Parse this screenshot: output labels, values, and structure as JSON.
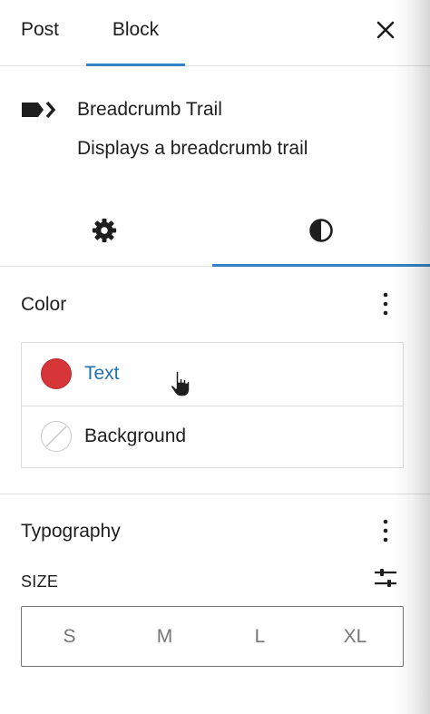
{
  "top_tabs": {
    "post": "Post",
    "block": "Block"
  },
  "block": {
    "title": "Breadcrumb Trail",
    "description": "Displays a breadcrumb trail"
  },
  "color": {
    "title": "Color",
    "items": [
      {
        "label": "Text",
        "swatch": "#d63638",
        "selected": true
      },
      {
        "label": "Background",
        "swatch": "none"
      }
    ]
  },
  "typography": {
    "title": "Typography",
    "size_label": "SIZE",
    "sizes": [
      "S",
      "M",
      "L",
      "XL"
    ]
  },
  "colors": {
    "accent": "#3582c4",
    "link": "#2271b1",
    "text_swatch": "#d63638"
  },
  "icons": [
    "close-icon",
    "breadcrumb-icon",
    "gear-icon",
    "contrast-icon",
    "more-vertical-icon",
    "sliders-icon",
    "hand-cursor-icon"
  ]
}
